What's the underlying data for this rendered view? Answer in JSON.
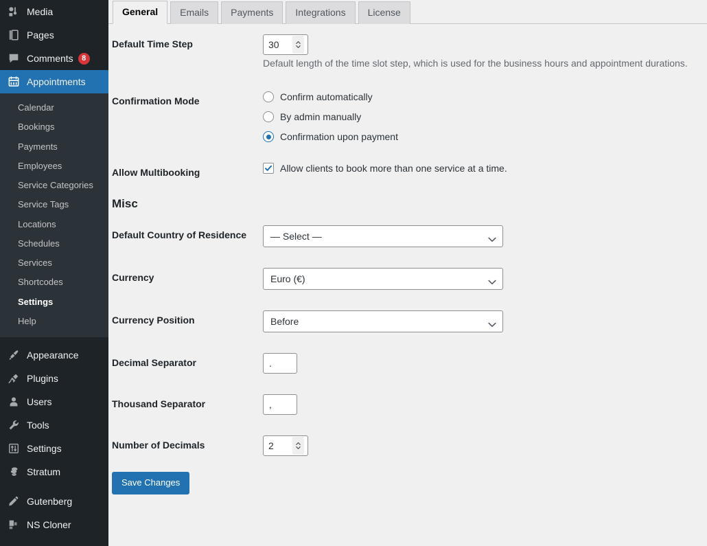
{
  "sidebar": {
    "top_items": [
      {
        "label": "Media",
        "icon": "media-icon",
        "badge": null
      },
      {
        "label": "Pages",
        "icon": "pages-icon",
        "badge": null
      },
      {
        "label": "Comments",
        "icon": "comments-icon",
        "badge": "8"
      }
    ],
    "active_item": {
      "label": "Appointments",
      "icon": "calendar-icon"
    },
    "submenu": [
      {
        "label": "Calendar",
        "current": false
      },
      {
        "label": "Bookings",
        "current": false
      },
      {
        "label": "Payments",
        "current": false
      },
      {
        "label": "Employees",
        "current": false
      },
      {
        "label": "Service Categories",
        "current": false
      },
      {
        "label": "Service Tags",
        "current": false
      },
      {
        "label": "Locations",
        "current": false
      },
      {
        "label": "Schedules",
        "current": false
      },
      {
        "label": "Services",
        "current": false
      },
      {
        "label": "Shortcodes",
        "current": false
      },
      {
        "label": "Settings",
        "current": true
      },
      {
        "label": "Help",
        "current": false
      }
    ],
    "bottom_items": [
      {
        "label": "Appearance",
        "icon": "paintbrush-icon"
      },
      {
        "label": "Plugins",
        "icon": "plug-icon"
      },
      {
        "label": "Users",
        "icon": "user-icon"
      },
      {
        "label": "Tools",
        "icon": "wrench-icon"
      },
      {
        "label": "Settings",
        "icon": "settings-sliders-icon"
      },
      {
        "label": "Stratum",
        "icon": "stratum-icon"
      }
    ],
    "plugin_items": [
      {
        "label": "Gutenberg",
        "icon": "pencil-icon"
      },
      {
        "label": "NS Cloner",
        "icon": "blocks-icon"
      }
    ],
    "colors": {
      "background": "#1d2327",
      "submenu_background": "#2c3338",
      "active_highlight": "#2271b1",
      "badge": "#d63638"
    }
  },
  "tabs": [
    {
      "label": "General",
      "active": true
    },
    {
      "label": "Emails",
      "active": false
    },
    {
      "label": "Payments",
      "active": false
    },
    {
      "label": "Integrations",
      "active": false
    },
    {
      "label": "License",
      "active": false
    }
  ],
  "form": {
    "time_step": {
      "label": "Default Time Step",
      "value": "30",
      "description": "Default length of the time slot step, which is used for the business hours and appointment durations."
    },
    "confirmation_mode": {
      "label": "Confirmation Mode",
      "options": [
        {
          "label": "Confirm automatically",
          "selected": false
        },
        {
          "label": "By admin manually",
          "selected": false
        },
        {
          "label": "Confirmation upon payment",
          "selected": true
        }
      ]
    },
    "multibooking": {
      "label": "Allow Multibooking",
      "checkbox_label": "Allow clients to book more than one service at a time.",
      "checked": true
    },
    "misc_heading": "Misc",
    "country": {
      "label": "Default Country of Residence",
      "value": "— Select —"
    },
    "currency": {
      "label": "Currency",
      "value": "Euro (€)"
    },
    "currency_position": {
      "label": "Currency Position",
      "value": "Before"
    },
    "decimal_separator": {
      "label": "Decimal Separator",
      "value": "."
    },
    "thousand_separator": {
      "label": "Thousand Separator",
      "value": ","
    },
    "number_of_decimals": {
      "label": "Number of Decimals",
      "value": "2"
    },
    "save_button": "Save Changes"
  }
}
